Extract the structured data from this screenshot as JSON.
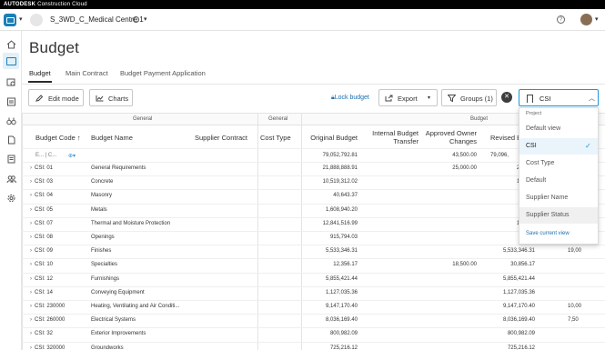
{
  "brand": {
    "name": "AUTODESK",
    "product": "Construction Cloud"
  },
  "project": {
    "name": "S_3WD_C_Medical Centre 1"
  },
  "page": {
    "title": "Budget"
  },
  "tabs": [
    "Budget",
    "Main Contract",
    "Budget Payment Application"
  ],
  "toolbar": {
    "edit_mode": "Edit mode",
    "charts": "Charts",
    "lock_budget": "Lock budget",
    "export": "Export",
    "groups": "Groups (1)",
    "view": "CSI"
  },
  "table": {
    "groups": [
      "General",
      "General",
      "Budget"
    ],
    "columns": [
      "Budget Code",
      "Budget Name",
      "Supplier Contract",
      "Cost Type",
      "Original Budget",
      "Internal Budget Transfer",
      "Approved Owner Changes",
      "Revised B"
    ],
    "filter": {
      "code": "E... | C...",
      "name": ""
    },
    "totals": {
      "original": "79,052,792.81",
      "approved": "43,500.00",
      "revised": "79,096,"
    },
    "rows": [
      {
        "code": "CSI: 01",
        "name": "General Requirements",
        "original": "21,888,888.91",
        "approved": "25,000.00",
        "revised": "21,913,",
        "extra": ""
      },
      {
        "code": "CSI: 03",
        "name": "Concrete",
        "original": "10,519,312.02",
        "approved": "",
        "revised": "10,519,",
        "extra": ""
      },
      {
        "code": "CSI: 04",
        "name": "Masonry",
        "original": "40,643.37",
        "approved": "",
        "revised": "40,",
        "extra": ""
      },
      {
        "code": "CSI: 05",
        "name": "Metals",
        "original": "1,608,940.20",
        "approved": "",
        "revised": "1,608,",
        "extra": ""
      },
      {
        "code": "CSI: 07",
        "name": "Thermal and Moisture Protection",
        "original": "12,841,516.99",
        "approved": "",
        "revised": "12,841,",
        "extra": ""
      },
      {
        "code": "CSI: 08",
        "name": "Openings",
        "original": "915,794.03",
        "approved": "",
        "revised": "915,",
        "extra": ""
      },
      {
        "code": "CSI: 09",
        "name": "Finishes",
        "original": "5,533,346.31",
        "approved": "",
        "revised": "5,533,346.31",
        "extra": "19,00"
      },
      {
        "code": "CSI: 10",
        "name": "Specialties",
        "original": "12,356.17",
        "approved": "18,500.00",
        "revised": "30,856.17",
        "extra": ""
      },
      {
        "code": "CSI: 12",
        "name": "Furnishings",
        "original": "5,855,421.44",
        "approved": "",
        "revised": "5,855,421.44",
        "extra": ""
      },
      {
        "code": "CSI: 14",
        "name": "Conveying Equipment",
        "original": "1,127,035.36",
        "approved": "",
        "revised": "1,127,035.36",
        "extra": ""
      },
      {
        "code": "CSI: 230000",
        "name": "Heating, Ventilating and Air Conditi...",
        "original": "9,147,170.40",
        "approved": "",
        "revised": "9,147,170.40",
        "extra": "10,00"
      },
      {
        "code": "CSI: 260000",
        "name": "Electrical Systems",
        "original": "8,036,169.40",
        "approved": "",
        "revised": "8,036,169.40",
        "extra": "7,50"
      },
      {
        "code": "CSI: 32",
        "name": "Exterior Improvements",
        "original": "800,982.09",
        "approved": "",
        "revised": "800,982.09",
        "extra": ""
      },
      {
        "code": "CSI: 320000",
        "name": "Groundworks",
        "original": "725,216.12",
        "approved": "",
        "revised": "725,216.12",
        "extra": ""
      }
    ]
  },
  "view_dropdown": {
    "group_label": "Project",
    "items": [
      "Default view",
      "CSI",
      "Cost Type",
      "Default",
      "Supplier Name",
      "Supplier Status"
    ],
    "selected": "CSI",
    "save_label": "Save current view"
  },
  "colors": {
    "accent": "#1f96d4",
    "link": "#1a6fb0",
    "app_icon": "#1a7fb8"
  }
}
